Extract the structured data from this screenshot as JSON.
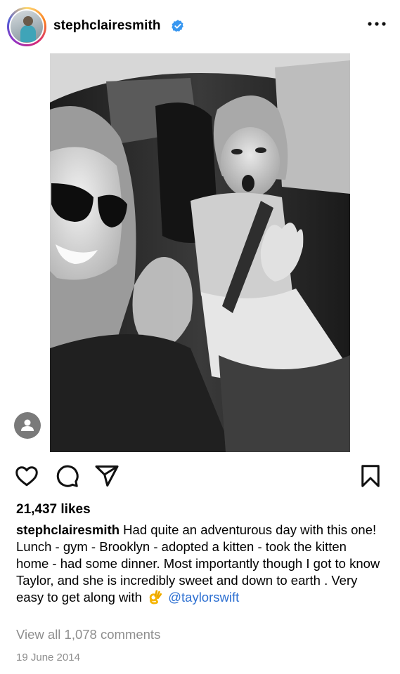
{
  "post": {
    "username": "stephclairesmith",
    "likes": "21,437 likes",
    "caption_text": "Had quite an adventurous day with this one! Lunch - gym - Brooklyn - adopted a kitten - took the kitten home - had some dinner. Most importantly though I got to know Taylor, and she is incredibly sweet and down to earth . Very easy to get along with",
    "caption_emoji": "ok-hand",
    "mention": "@taylorswift",
    "view_comments": "View all 1,078 comments",
    "date": "19 June 2014"
  },
  "icons": {
    "verified": "verified-badge-icon",
    "more": "more-options-icon",
    "like": "heart-icon",
    "comment": "comment-icon",
    "share": "send-icon",
    "save": "bookmark-icon",
    "user_tag": "user-tag-icon"
  },
  "colors": {
    "verified": "#3897f0",
    "mention": "#2c6fd1",
    "muted": "#8e8e8e"
  }
}
